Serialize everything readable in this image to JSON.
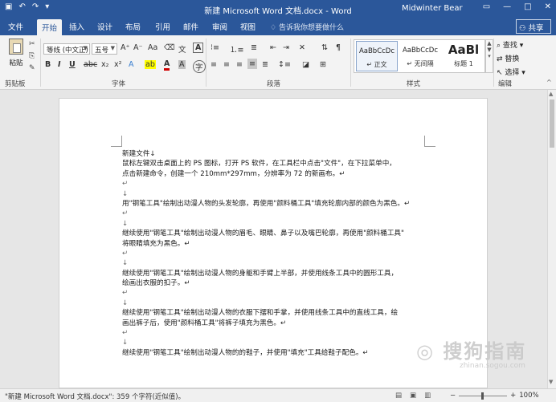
{
  "window": {
    "title": "新建 Microsoft Word 文档.docx - Word",
    "user": "Midwinter Bear"
  },
  "tabs": [
    "文件",
    "开始",
    "插入",
    "设计",
    "布局",
    "引用",
    "邮件",
    "审阅",
    "视图"
  ],
  "active_tab": "开始",
  "tell_me": "告诉我你想要做什么",
  "share": "共享",
  "ribbon": {
    "clipboard": {
      "paste": "粘贴",
      "group": "剪贴板"
    },
    "font": {
      "name": "等线 (中文正)",
      "size": "五号",
      "group": "字体",
      "buttons": [
        "B",
        "I",
        "U",
        "abc",
        "x₂",
        "x²",
        "A",
        "Aa",
        "A⁺",
        "A⁻",
        "A"
      ]
    },
    "paragraph": {
      "group": "段落"
    },
    "styles": {
      "group": "样式",
      "items": [
        {
          "sample": "AaBbCcDc",
          "name": "↵ 正文"
        },
        {
          "sample": "AaBbCcDc",
          "name": "↵ 无间隔"
        },
        {
          "sample": "AaBl",
          "name": "标题 1"
        }
      ]
    },
    "editing": {
      "group": "编辑",
      "find": "查找",
      "replace": "替换",
      "select": "选择"
    }
  },
  "document": {
    "lines": [
      "新建文件↓",
      "鼠标左键双击桌面上的 PS 图标，打开 PS 软件，在工具栏中点击\"文件\"，在下拉菜单中，",
      "点击新建命令，创建一个 210mm*297mm，分辨率为 72 的新画布。↵",
      "↵",
      "↓",
      "用\"钢笔工具\"绘制出动漫人物的头发轮廓，再使用\"颜料桶工具\"填充轮廓内部的颜色为黑色。↵",
      "↵",
      "↓",
      "继续使用\"钢笔工具\"绘制出动漫人物的眉毛、眼睛、鼻子以及嘴巴轮廓，再使用\"颜料桶工具\"",
      "将眼睛填充为黑色。↵",
      "↵",
      "↓",
      "继续使用\"钢笔工具\"绘制出动漫人物的身躯和手臂上半部，并使用线条工具中的圆形工具，",
      "绘画出衣服的扣子。↵",
      "↵",
      "↓",
      "继续使用\"钢笔工具\"绘制出动漫人物的衣服下摆和手掌，并使用线条工具中的直线工具，绘",
      "画出裤子后，使用\"颜料桶工具\"将裤子填充为黑色。↵",
      "↵",
      "↓",
      "继续使用\"钢笔工具\"绘制出动漫人物的的鞋子，并使用\"填充\"工具给鞋子配色。↵"
    ]
  },
  "status": {
    "text": "\"新建 Microsoft Word 文档.docx\": 359 个字符(近似值)。",
    "zoom": "100%"
  },
  "watermark": {
    "main": "搜狗指南",
    "sub": "zhinan.sogou.com"
  }
}
